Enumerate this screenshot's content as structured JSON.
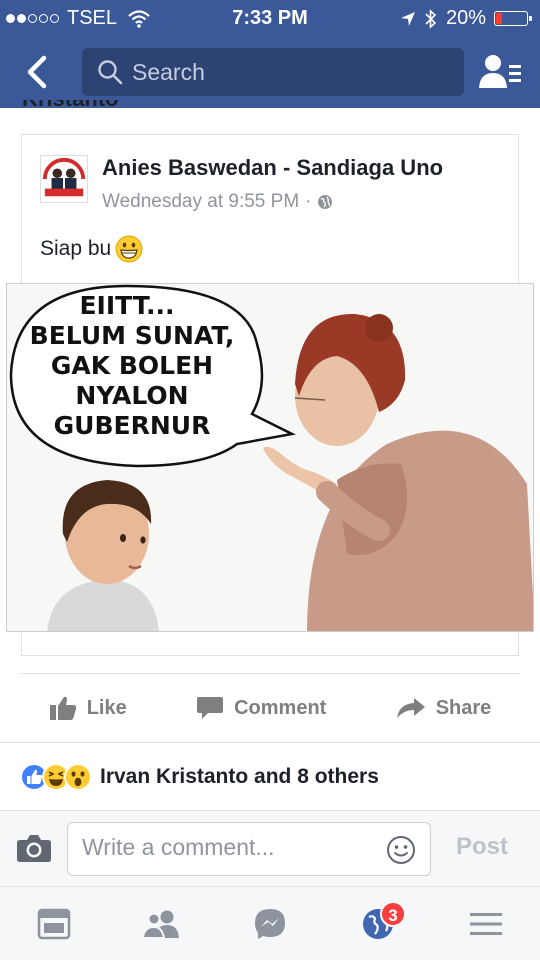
{
  "status_bar": {
    "carrier": "TSEL",
    "time": "7:33 PM",
    "battery": "20%",
    "battery_level_percent": 20,
    "signal_bars_filled": 2,
    "signal_bars_total": 5
  },
  "nav": {
    "search_placeholder": "Search"
  },
  "post": {
    "page_name": "Anies Baswedan - Sandiaga Uno",
    "timestamp": "Wednesday at 9:55 PM",
    "separator": "·",
    "text": "Siap bu",
    "text_emoji": "grinning-face-emoji",
    "image": {
      "speech_bubble_lines": [
        "EIITT...",
        "BELUM SUNAT,",
        "GAK BOLEH",
        "NYALON",
        "GUBERNUR"
      ]
    }
  },
  "actions": {
    "like_label": "Like",
    "comment_label": "Comment",
    "share_label": "Share"
  },
  "reactions": {
    "icons": [
      "like-reaction-icon",
      "haha-reaction-icon",
      "wow-reaction-icon"
    ],
    "summary": "Irvan Kristanto and 8 others"
  },
  "composer": {
    "placeholder": "Write a comment...",
    "post_label": "Post"
  },
  "tabbar": {
    "items": [
      "news-feed-icon",
      "friends-icon",
      "messenger-icon",
      "notifications-globe-icon",
      "menu-icon"
    ],
    "notifications_badge": "3"
  },
  "colors": {
    "brand_blue": "#3b5998",
    "search_bg": "#2d4373",
    "muted_text": "#90949c",
    "badge_red": "#fa3e3e",
    "like_blue": "#4080ff"
  }
}
